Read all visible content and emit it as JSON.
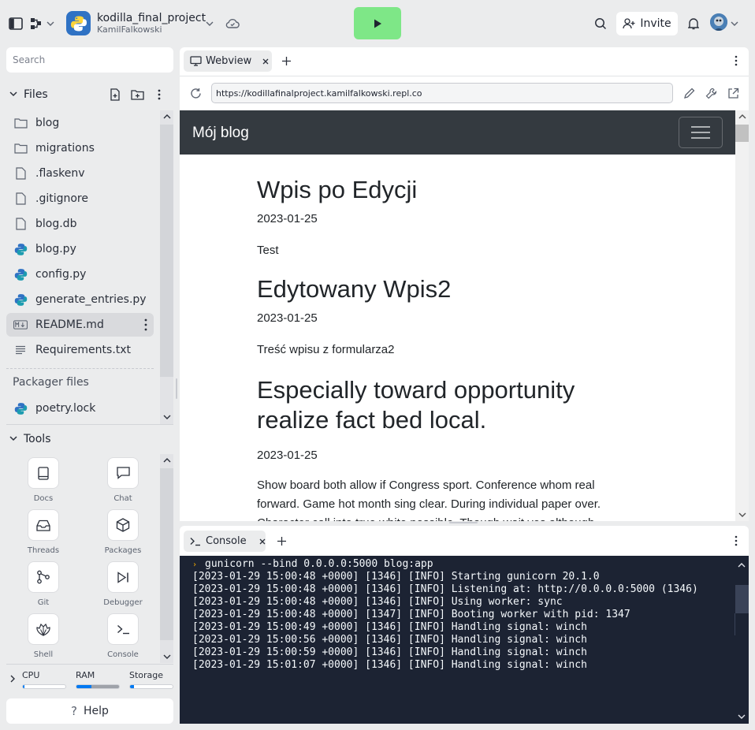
{
  "project": {
    "name": "kodilla_final_project",
    "owner": "KamilFalkowski"
  },
  "header": {
    "invite_label": "Invite"
  },
  "sidebar": {
    "search_placeholder": "Search",
    "files_title": "Files",
    "files": [
      {
        "name": "blog",
        "icon": "folder-icon"
      },
      {
        "name": "migrations",
        "icon": "folder-icon"
      },
      {
        "name": ".flaskenv",
        "icon": "file-icon"
      },
      {
        "name": ".gitignore",
        "icon": "file-icon"
      },
      {
        "name": "blog.db",
        "icon": "file-icon"
      },
      {
        "name": "blog.py",
        "icon": "python-icon"
      },
      {
        "name": "config.py",
        "icon": "python-icon"
      },
      {
        "name": "generate_entries.py",
        "icon": "python-icon"
      },
      {
        "name": "README.md",
        "icon": "markdown-icon",
        "selected": true
      },
      {
        "name": "Requirements.txt",
        "icon": "text-file-icon"
      }
    ],
    "packager_title": "Packager files",
    "packager_files": [
      {
        "name": "poetry.lock",
        "icon": "python-icon"
      }
    ],
    "tools_title": "Tools",
    "tools": [
      {
        "label": "Docs",
        "icon": "book-icon"
      },
      {
        "label": "Chat",
        "icon": "chat-icon"
      },
      {
        "label": "Threads",
        "icon": "inbox-icon"
      },
      {
        "label": "Packages",
        "icon": "package-icon"
      },
      {
        "label": "Git",
        "icon": "git-icon"
      },
      {
        "label": "Debugger",
        "icon": "debugger-icon"
      },
      {
        "label": "Shell",
        "icon": "shell-icon"
      },
      {
        "label": "Console",
        "icon": "terminal-icon"
      }
    ],
    "resources": [
      {
        "label": "CPU",
        "level": 0.03
      },
      {
        "label": "RAM",
        "level": 0.35
      },
      {
        "label": "Storage",
        "level": 0.1
      }
    ],
    "help_label": "Help"
  },
  "webview": {
    "tab_label": "Webview",
    "url": "https://kodillafinalproject.kamilfalkowski.repl.co",
    "brand": "Mój blog",
    "posts": [
      {
        "title": "Wpis po Edycji",
        "date": "2023-01-25",
        "body": "Test"
      },
      {
        "title": "Edytowany Wpis2",
        "date": "2023-01-25",
        "body": "Treść wpisu z formularza2"
      },
      {
        "title": "Especially toward opportunity realize fact bed local.",
        "date": "2023-01-25",
        "body": "Show board both allow if Congress sport. Conference whom real forward. Game hot month sing clear. During individual paper over. Character call into true white possible. Though wait yes although"
      }
    ]
  },
  "console": {
    "tab_label": "Console",
    "command": "gunicorn --bind 0.0.0.0:5000 blog:app",
    "lines": [
      "[2023-01-29 15:00:48 +0000] [1346] [INFO] Starting gunicorn 20.1.0",
      "[2023-01-29 15:00:48 +0000] [1346] [INFO] Listening at: http://0.0.0.0:5000 (1346)",
      "[2023-01-29 15:00:48 +0000] [1346] [INFO] Using worker: sync",
      "[2023-01-29 15:00:48 +0000] [1347] [INFO] Booting worker with pid: 1347",
      "[2023-01-29 15:00:49 +0000] [1346] [INFO] Handling signal: winch",
      "[2023-01-29 15:00:56 +0000] [1346] [INFO] Handling signal: winch",
      "[2023-01-29 15:00:59 +0000] [1346] [INFO] Handling signal: winch",
      "[2023-01-29 15:01:07 +0000] [1346] [INFO] Handling signal: winch"
    ]
  },
  "colors": {
    "run_button": "#7ee787",
    "console_bg": "#1c2333",
    "blog_navbar": "#343a40",
    "accent": "#0079f2"
  }
}
